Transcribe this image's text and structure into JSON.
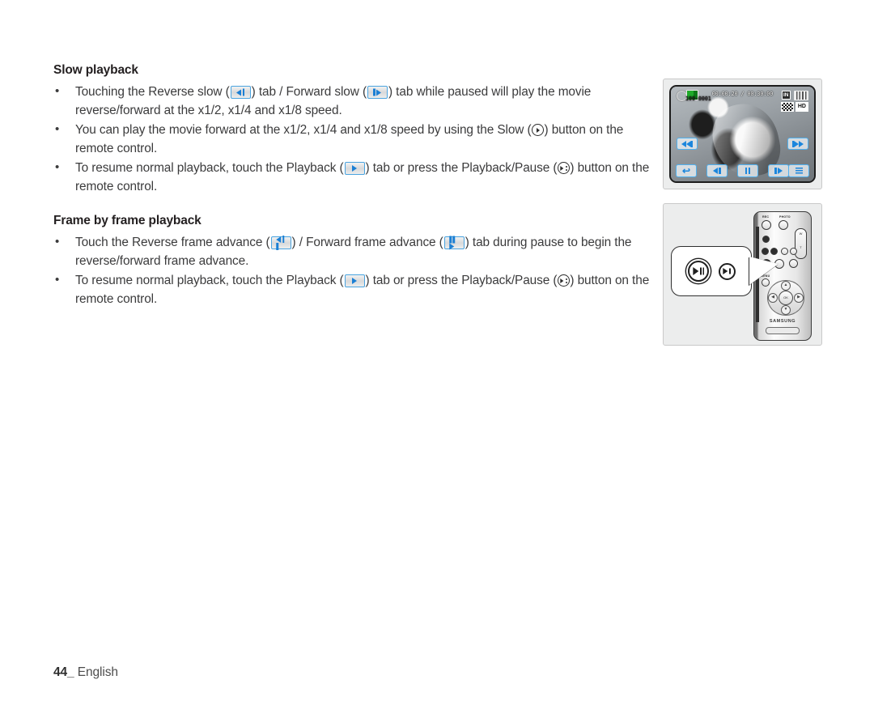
{
  "page": {
    "footer_page_number": "44_",
    "footer_language": "English"
  },
  "sections": [
    {
      "heading": "Slow playback",
      "bullets": [
        {
          "parts": [
            {
              "t": "text",
              "v": "Touching the Reverse slow ("
            },
            {
              "t": "tab",
              "icon": "reverse-slow-tab-icon"
            },
            {
              "t": "text",
              "v": ") tab / Forward slow ("
            },
            {
              "t": "tab",
              "icon": "forward-slow-tab-icon"
            },
            {
              "t": "text",
              "v": ") tab while paused will play the movie reverse/forward at the x1/2, x1/4 and x1/8 speed."
            }
          ]
        },
        {
          "parts": [
            {
              "t": "text",
              "v": "You can play the movie forward at the x1/2, x1/4 and x1/8 speed by using the Slow ("
            },
            {
              "t": "glyph",
              "icon": "slow-button-glyph"
            },
            {
              "t": "text",
              "v": ") button on the remote control."
            }
          ]
        },
        {
          "parts": [
            {
              "t": "text",
              "v": "To resume normal playback, touch the Playback ("
            },
            {
              "t": "tab",
              "icon": "playback-tab-icon"
            },
            {
              "t": "text",
              "v": ") tab or press the Playback/Pause ("
            },
            {
              "t": "glyph",
              "icon": "playback-pause-button-glyph"
            },
            {
              "t": "text",
              "v": ") button on the remote control."
            }
          ]
        }
      ]
    },
    {
      "heading": "Frame by frame playback",
      "bullets": [
        {
          "parts": [
            {
              "t": "text",
              "v": "Touch the Reverse frame advance ("
            },
            {
              "t": "tab",
              "icon": "reverse-frame-advance-tab-icon"
            },
            {
              "t": "text",
              "v": ") / Forward frame advance ("
            },
            {
              "t": "tab",
              "icon": "forward-frame-advance-tab-icon"
            },
            {
              "t": "text",
              "v": ") tab during pause to begin the reverse/forward frame advance."
            }
          ]
        },
        {
          "parts": [
            {
              "t": "text",
              "v": "To resume normal playback, touch the Playback ("
            },
            {
              "t": "tab",
              "icon": "playback-tab-icon"
            },
            {
              "t": "text",
              "v": ") tab or press the Playback/Pause ("
            },
            {
              "t": "glyph",
              "icon": "playback-pause-button-glyph"
            },
            {
              "t": "text",
              "v": ") button on the remote control."
            }
          ]
        }
      ]
    }
  ],
  "lcd_figure": {
    "osd": {
      "elapsed_total_time": "00:00:20 / 00:30:00",
      "file_number": "100-0001",
      "storage_badge": "IN",
      "quality_badge": "HD"
    },
    "tabs": {
      "skip_previous": "skip-previous-tab",
      "skip_next": "skip-next-tab",
      "return": "return-tab",
      "reverse_slow": "reverse-slow-tab",
      "pause": "pause-tab",
      "forward_slow": "forward-slow-tab",
      "menu": "menu-tab"
    }
  },
  "remote_figure": {
    "brand": "SAMSUNG",
    "labels": {
      "rec": "REC",
      "photo": "PHOTO",
      "zoom_wide": "W",
      "zoom_tele": "T",
      "menu": "MENU",
      "ok": "OK"
    },
    "callout": {
      "playback_pause_button": "playback-pause-button",
      "slow_button": "slow-button"
    }
  },
  "colors": {
    "tab_border": "#4aa3df",
    "tab_glyph": "#1b7fd4",
    "text": "#3b3b3c",
    "heading": "#231f20"
  }
}
